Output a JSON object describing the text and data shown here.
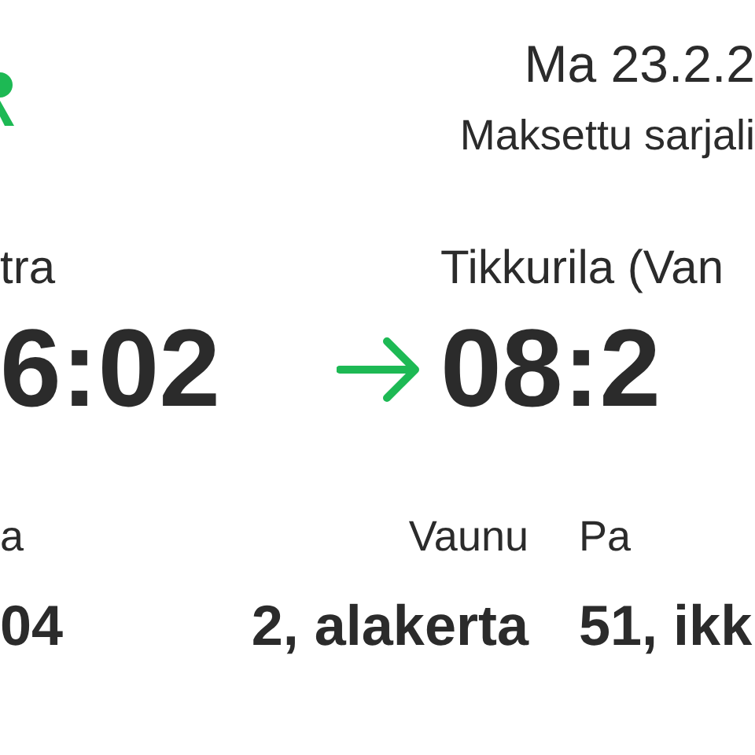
{
  "header": {
    "date": "Ma 23.2.2",
    "ticket_type": "Maksettu sarjali"
  },
  "journey": {
    "from": {
      "station": "tra",
      "time": "6:02"
    },
    "to": {
      "station": "Tikkurila (Van",
      "time": "08:2"
    }
  },
  "details": [
    {
      "label": "a",
      "value": "04"
    },
    {
      "label": "Vaunu",
      "value": "2, alakerta"
    },
    {
      "label": "Pa",
      "value": "51, ikk"
    }
  ]
}
